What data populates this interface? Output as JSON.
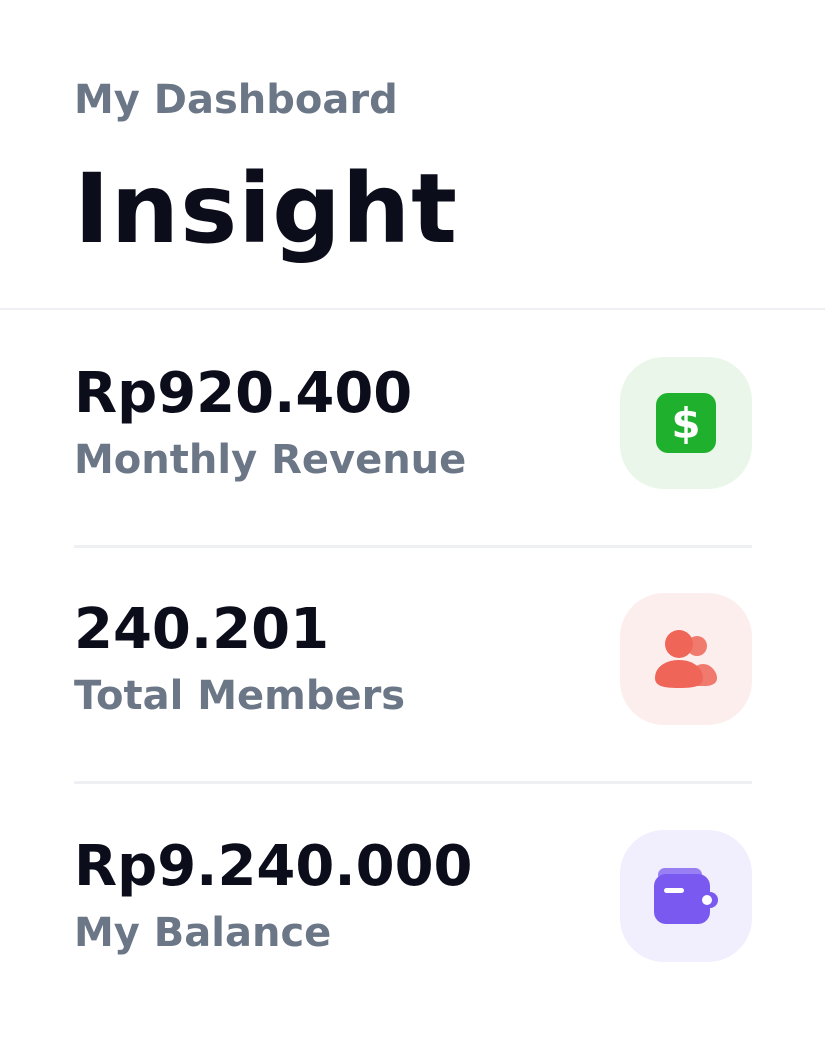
{
  "header": {
    "subtitle": "My Dashboard",
    "title": "Insight"
  },
  "stats": [
    {
      "value": "Rp920.400",
      "label": "Monthly Revenue",
      "icon": "dollar-icon",
      "tile_color": "#e9f6e9",
      "icon_color": "#1fb12e"
    },
    {
      "value": "240.201",
      "label": "Total Members",
      "icon": "users-icon",
      "tile_color": "#fdeeee",
      "icon_color": "#ef6557"
    },
    {
      "value": "Rp9.240.000",
      "label": "My Balance",
      "icon": "wallet-icon",
      "tile_color": "#f1eefd",
      "icon_color": "#7a59f0"
    }
  ]
}
